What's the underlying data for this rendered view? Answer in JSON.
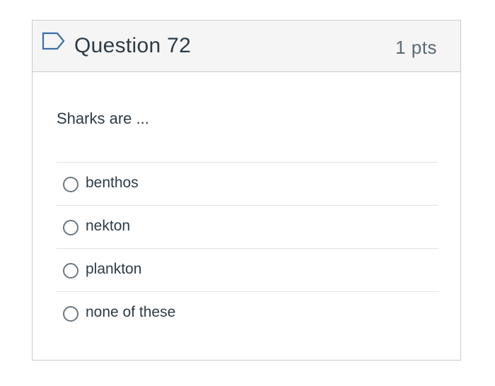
{
  "question": {
    "title": "Question 72",
    "points": "1 pts",
    "text": "Sharks are ...",
    "flag_icon": "flag-outline-icon"
  },
  "answers": [
    {
      "label": "benthos",
      "selected": false
    },
    {
      "label": "nekton",
      "selected": false
    },
    {
      "label": "plankton",
      "selected": false
    },
    {
      "label": "none of these",
      "selected": false
    }
  ],
  "colors": {
    "accent": "#3b6fa8",
    "header_bg": "#f5f5f5",
    "border": "#c7cdd1",
    "text": "#2d3b45"
  }
}
